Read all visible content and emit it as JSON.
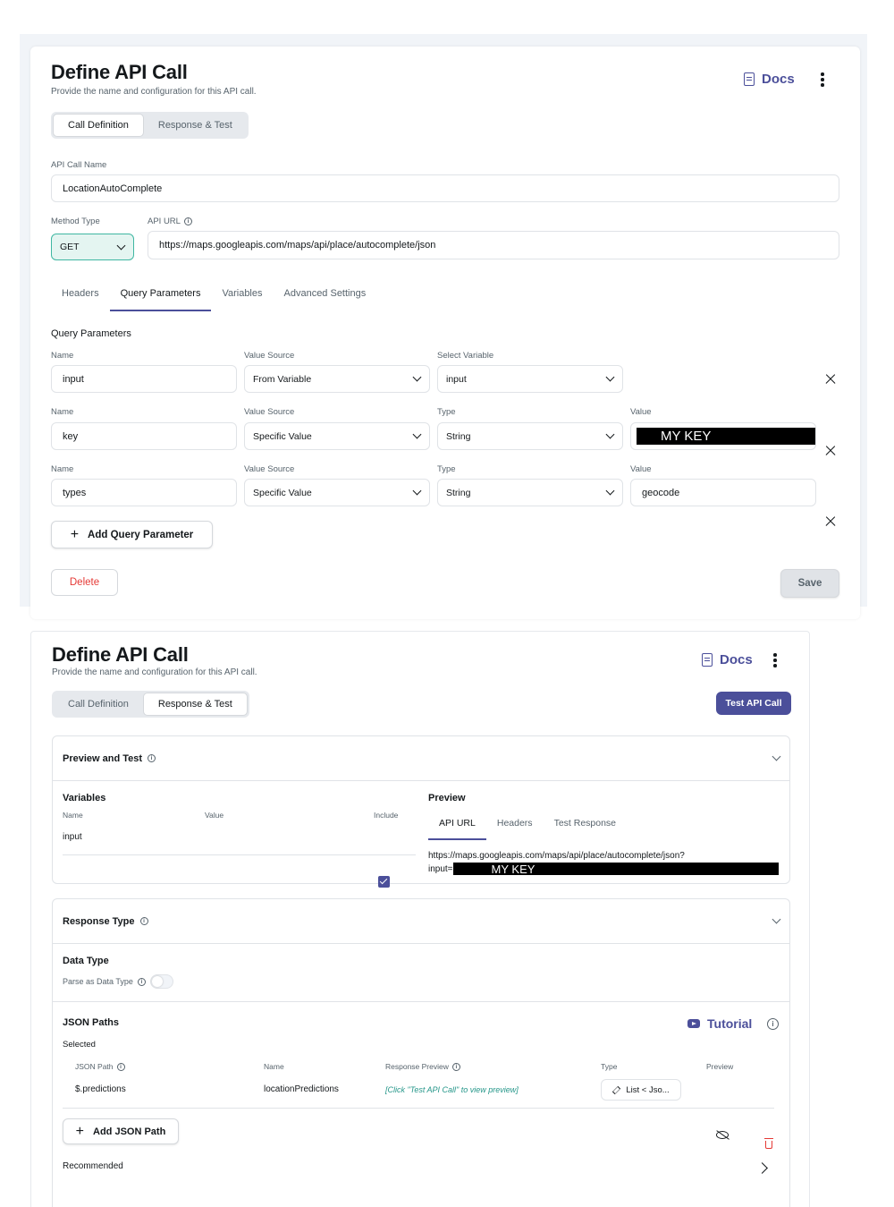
{
  "panel1": {
    "title": "Define API Call",
    "subtitle": "Provide the name and configuration for this API call.",
    "docs_label": "Docs",
    "tabs": [
      "Call Definition",
      "Response & Test"
    ],
    "api_call_name_label": "API Call Name",
    "api_call_name_value": "LocationAutoComplete",
    "method_type_label": "Method Type",
    "method_type_value": "GET",
    "api_url_label": "API URL",
    "api_url_value": "https://maps.googleapis.com/maps/api/place/autocomplete/json",
    "sub_tabs": [
      "Headers",
      "Query Parameters",
      "Variables",
      "Advanced Settings"
    ],
    "active_sub_tab": "Query Parameters",
    "query_params_heading": "Query Parameters",
    "params": [
      {
        "name_label": "Name",
        "name": "input",
        "source_label": "Value Source",
        "source": "From Variable",
        "third_label": "Select Variable",
        "third": "input",
        "value_label": "",
        "value": ""
      },
      {
        "name_label": "Name",
        "name": "key",
        "source_label": "Value Source",
        "source": "Specific Value",
        "third_label": "Type",
        "third": "String",
        "value_label": "Value",
        "value": "MY KEY"
      },
      {
        "name_label": "Name",
        "name": "types",
        "source_label": "Value Source",
        "source": "Specific Value",
        "third_label": "Type",
        "third": "String",
        "value_label": "Value",
        "value": "geocode"
      }
    ],
    "add_param_label": "Add Query Parameter",
    "delete_label": "Delete",
    "save_label": "Save"
  },
  "panel2": {
    "title": "Define API Call",
    "subtitle": "Provide the name and configuration for this API call.",
    "docs_label": "Docs",
    "tabs": [
      "Call Definition",
      "Response & Test"
    ],
    "test_button_label": "Test API Call",
    "preview_section": {
      "title": "Preview and Test",
      "variables_heading": "Variables",
      "col_name": "Name",
      "col_value": "Value",
      "col_include": "Include",
      "variable_name": "input",
      "variable_included": true,
      "preview_heading": "Preview",
      "preview_tabs": [
        "API URL",
        "Headers",
        "Test Response"
      ],
      "active_preview_tab": "API URL",
      "url_line1": "https://maps.googleapis.com/maps/api/place/autocomplete/json?",
      "url_line2_prefix": "input=",
      "url_redacted": "MY KEY"
    },
    "response_section": {
      "title": "Response Type",
      "data_type_heading": "Data Type",
      "parse_label": "Parse as Data Type",
      "parse_enabled": false,
      "json_paths_heading": "JSON Paths",
      "tutorial_label": "Tutorial",
      "selected_label": "Selected",
      "columns": [
        "JSON Path",
        "Name",
        "Response Preview",
        "Type",
        "Preview"
      ],
      "row": {
        "path": "$.predictions",
        "name": "locationPredictions",
        "preview": "[Click \"Test API Call\" to view preview]",
        "type": "List < Jso..."
      },
      "add_json_path_label": "Add JSON Path",
      "recommended_label": "Recommended"
    }
  },
  "colors": {
    "accent": "#4b4f9a",
    "teal": "#3fb7a2",
    "danger": "#e53935",
    "hint": "#249689"
  }
}
